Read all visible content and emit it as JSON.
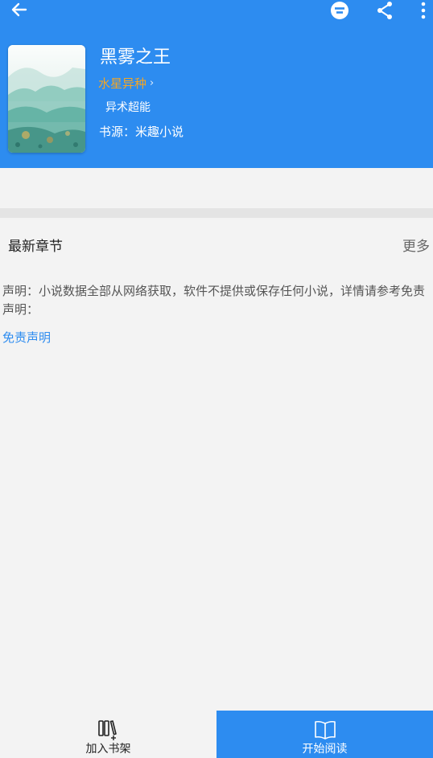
{
  "header": {
    "icons": {
      "back": "arrow-left-icon",
      "filter": "filter-circle-icon",
      "share": "share-icon",
      "more": "more-vertical-icon"
    }
  },
  "book": {
    "title": "黑雾之王",
    "author": "水星异种",
    "author_chevron": "›",
    "tags": "异术超能",
    "source": "书源：米趣小说"
  },
  "chapters": {
    "heading": "最新章节",
    "more_label": "更多"
  },
  "disclaimer": {
    "text": "声明：小说数据全部从网络获取，软件不提供或保存任何小说，详情请参考免责声明：",
    "link_label": "免责声明"
  },
  "bottom_bar": {
    "add_to_shelf_label": "加入书架",
    "start_reading_label": "开始阅读"
  },
  "colors": {
    "primary": "#2d8cf0",
    "author": "#f5a623",
    "background": "#f3f3f3"
  }
}
